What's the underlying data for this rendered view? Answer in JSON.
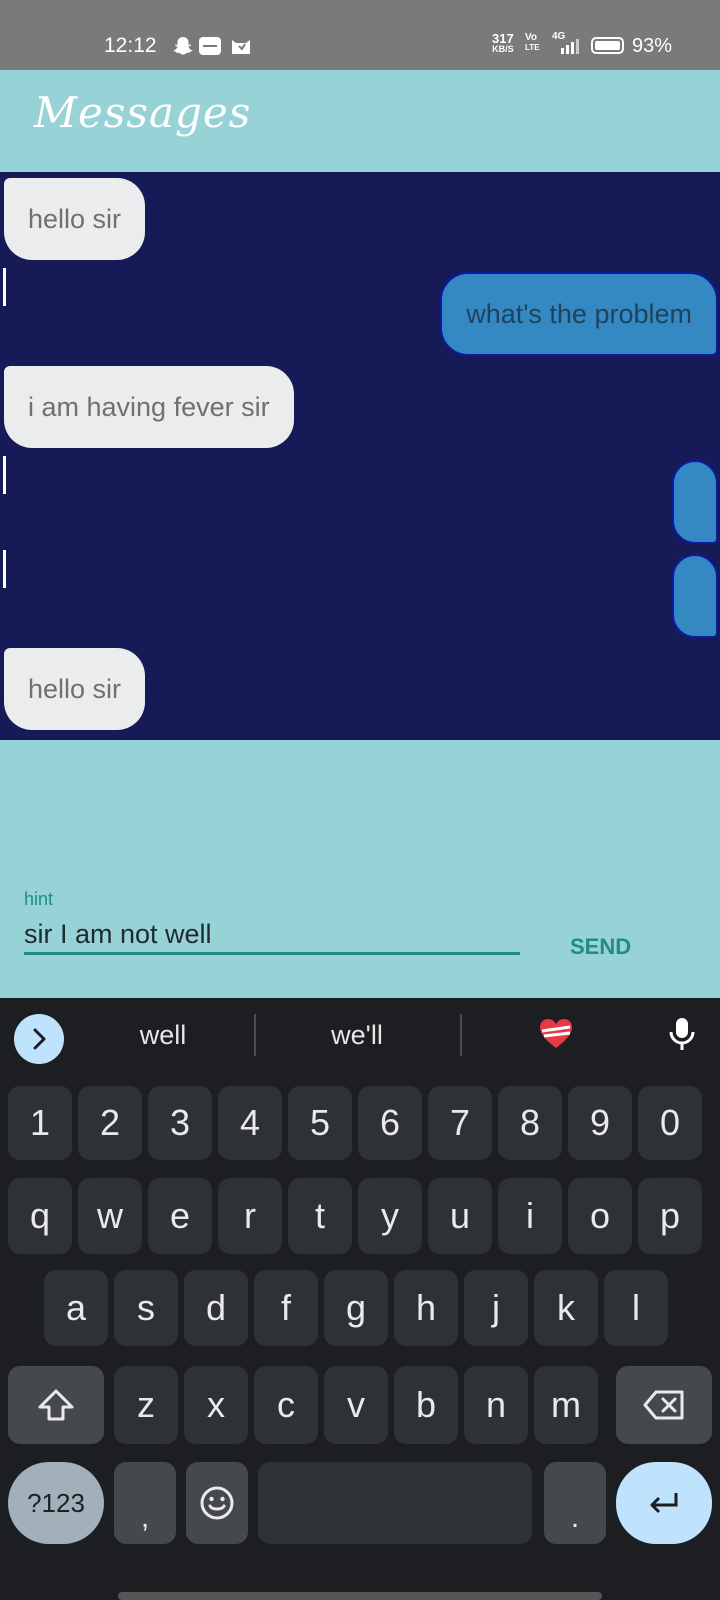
{
  "status_bar": {
    "time": "12:12",
    "speed_top": "317",
    "speed_unit": "KB/S",
    "volte_top": "Vo",
    "volte_bottom": "LTE",
    "network": "4G",
    "battery": "93%"
  },
  "app": {
    "title": "Messages"
  },
  "messages": [
    {
      "side": "incoming",
      "text": "hello sir"
    },
    {
      "side": "outgoing",
      "text": "what's the problem"
    },
    {
      "side": "incoming",
      "text": "i am having fever sir"
    },
    {
      "side": "outgoing",
      "text": ""
    },
    {
      "side": "outgoing",
      "text": ""
    },
    {
      "side": "incoming",
      "text": "hello sir"
    }
  ],
  "composer": {
    "hint_label": "hint",
    "input_value": "sir I am not well",
    "send_label": "SEND"
  },
  "keyboard": {
    "suggestions": [
      "well",
      "we'll"
    ],
    "row_numbers": [
      "1",
      "2",
      "3",
      "4",
      "5",
      "6",
      "7",
      "8",
      "9",
      "0"
    ],
    "row_top": [
      "q",
      "w",
      "e",
      "r",
      "t",
      "y",
      "u",
      "i",
      "o",
      "p"
    ],
    "row_home": [
      "a",
      "s",
      "d",
      "f",
      "g",
      "h",
      "j",
      "k",
      "l"
    ],
    "row_bottom": [
      "z",
      "x",
      "c",
      "v",
      "b",
      "n",
      "m"
    ],
    "symbols_label": "?123",
    "comma_label": ",",
    "period_label": "."
  },
  "colors": {
    "chat_background": "#161b57",
    "page_background": "#96d2d6",
    "outgoing_bubble": "#3489c3",
    "incoming_bubble": "#eaeced",
    "accent": "#1f8d82"
  }
}
